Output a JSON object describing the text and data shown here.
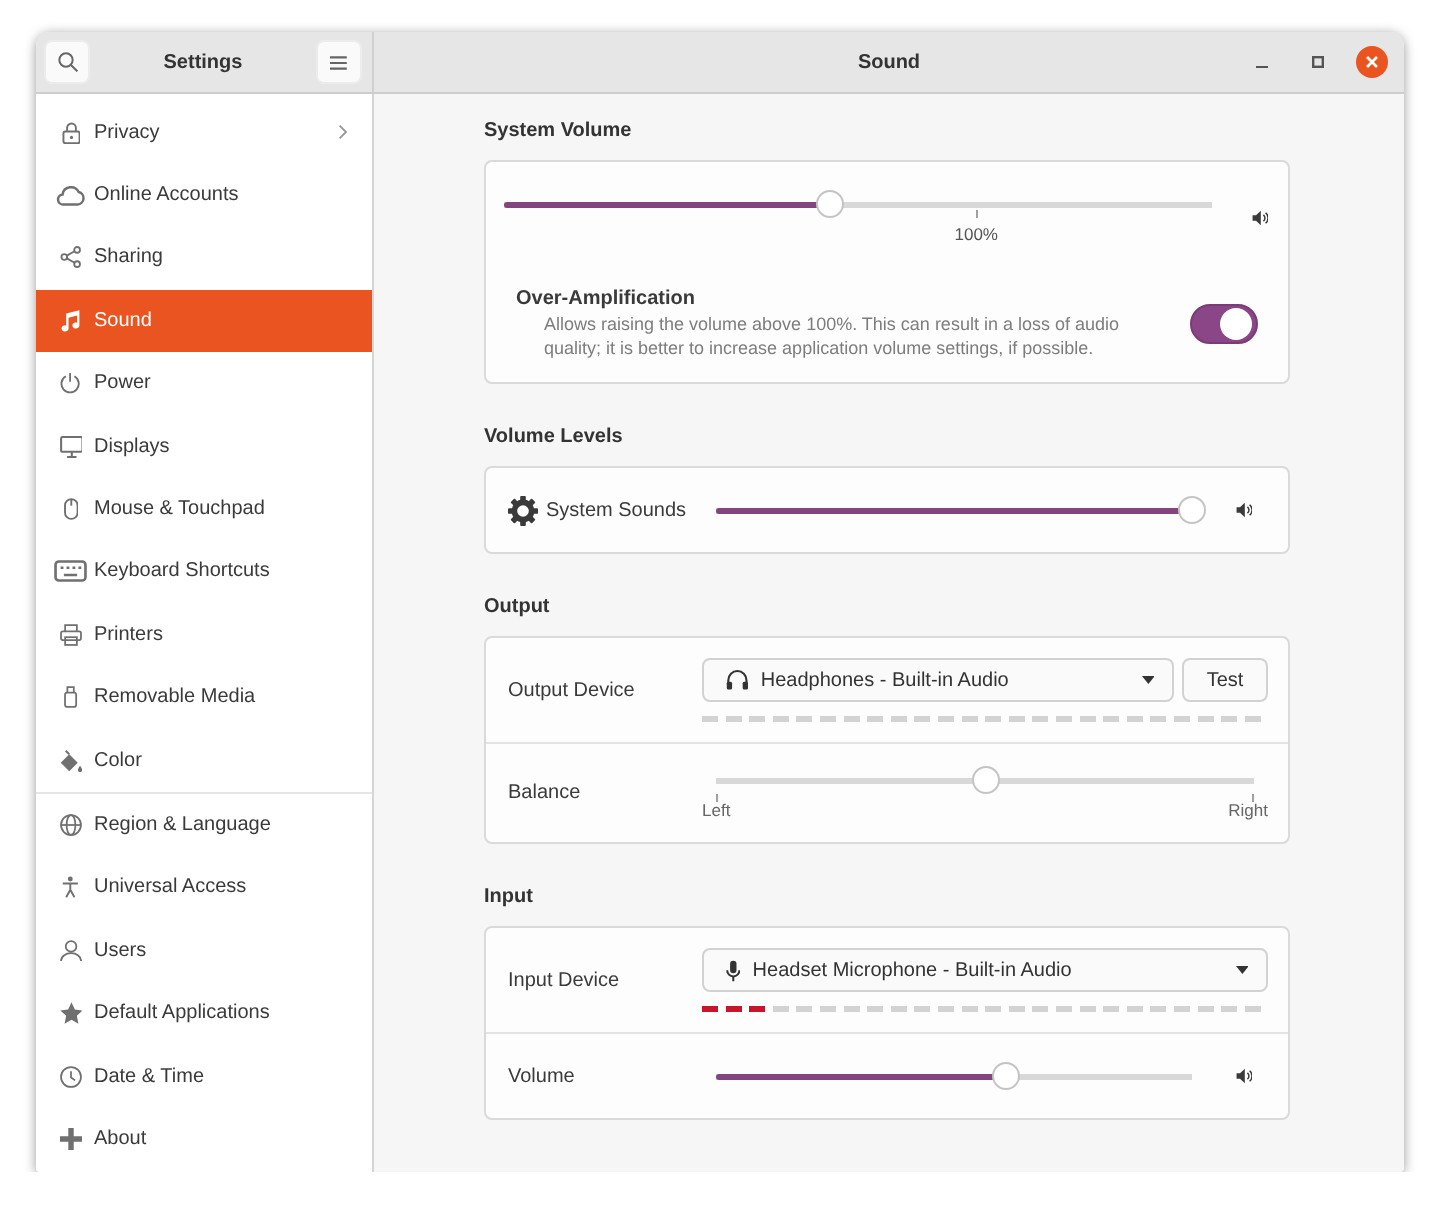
{
  "header": {
    "sidebar_title": "Settings",
    "title": "Sound"
  },
  "sidebar": {
    "groups": [
      {
        "items": [
          {
            "label": "Privacy",
            "submenu": true,
            "selected": false
          },
          {
            "label": "Online Accounts",
            "submenu": false,
            "selected": false
          },
          {
            "label": "Sharing",
            "submenu": false,
            "selected": false
          },
          {
            "label": "Sound",
            "submenu": false,
            "selected": true
          },
          {
            "label": "Power",
            "submenu": false,
            "selected": false
          },
          {
            "label": "Displays",
            "submenu": false,
            "selected": false
          },
          {
            "label": "Mouse & Touchpad",
            "submenu": false,
            "selected": false
          },
          {
            "label": "Keyboard Shortcuts",
            "submenu": false,
            "selected": false
          },
          {
            "label": "Printers",
            "submenu": false,
            "selected": false
          },
          {
            "label": "Removable Media",
            "submenu": false,
            "selected": false
          },
          {
            "label": "Color",
            "submenu": false,
            "selected": false
          }
        ]
      },
      {
        "items": [
          {
            "label": "Region & Language",
            "submenu": false,
            "selected": false
          },
          {
            "label": "Universal Access",
            "submenu": false,
            "selected": false
          },
          {
            "label": "Users",
            "submenu": false,
            "selected": false
          },
          {
            "label": "Default Applications",
            "submenu": false,
            "selected": false
          },
          {
            "label": "Date & Time",
            "submenu": false,
            "selected": false
          },
          {
            "label": "About",
            "submenu": false,
            "selected": false
          }
        ]
      }
    ]
  },
  "sections": [
    {
      "title": "System Volume",
      "rows": [
        {
          "kind": "volume",
          "level": 0.46,
          "mark_label": "100%"
        },
        {
          "kind": "switch",
          "title": "Over-Amplification",
          "description": "Allows raising the volume above 100%. This can result in a loss of audio quality; it is better to increase application volume settings, if possible.",
          "on": true
        }
      ]
    },
    {
      "title": "Volume Levels",
      "rows": [
        {
          "kind": "stream",
          "label": "System Sounds",
          "level": 1
        }
      ]
    },
    {
      "title": "Output",
      "rows": [
        {
          "kind": "output_device",
          "label": "Output Device",
          "value": "Headphones - Built-in Audio",
          "button": "Test",
          "meter": {
            "level": 0
          }
        },
        {
          "kind": "balance",
          "label": "Balance",
          "level": 0.5,
          "left_label": "Left",
          "right_label": "Right"
        }
      ]
    },
    {
      "title": "Input",
      "rows": [
        {
          "kind": "input_device",
          "label": "Input Device",
          "value": "Headset Microphone - Built-in Audio",
          "meter": {
            "level": 0.12
          }
        },
        {
          "kind": "slider",
          "label": "Volume",
          "level": 0.61
        }
      ]
    }
  ]
}
